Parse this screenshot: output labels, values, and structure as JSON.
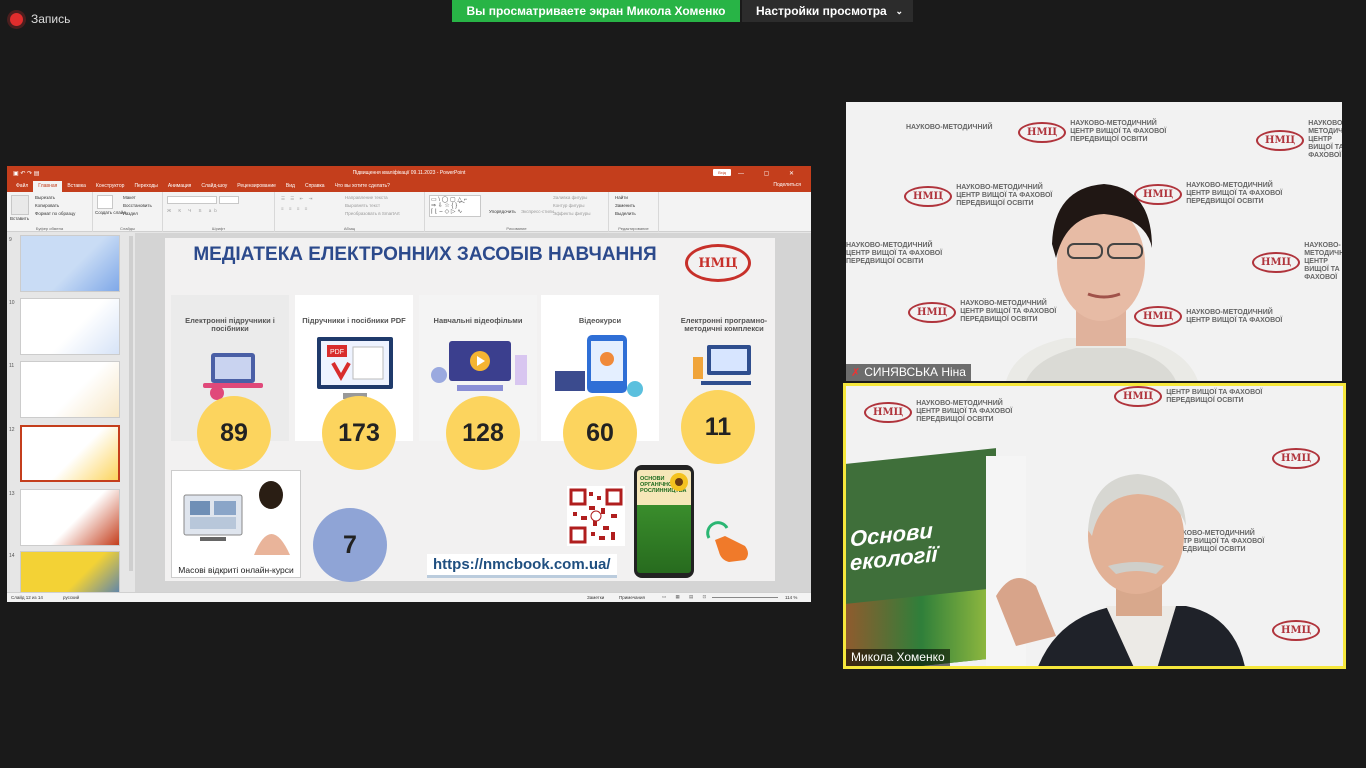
{
  "top_bar": {
    "recording_label": "Запись",
    "viewing_banner": "Вы просматриваете экран Микола Хоменко",
    "view_options_label": "Настройки просмотра"
  },
  "powerpoint": {
    "title": "Підвищення кваліфікації 09.11.2023 - PowerPoint",
    "sign_in": "Вхід",
    "window_controls": "— ▢ ✕",
    "tabs": [
      "Файл",
      "Главная",
      "Вставка",
      "Конструктор",
      "Переходы",
      "Анимация",
      "Слайд-шоу",
      "Рецензирование",
      "Вид",
      "Справка",
      "Что вы хотите сделать?"
    ],
    "active_tab": "Главная",
    "share": "Поделиться",
    "ribbon": {
      "clipboard": {
        "label": "Буфер обмена",
        "paste": "Вставить",
        "cut": "Вырезать",
        "copy": "Копировать",
        "format": "Формат по образцу"
      },
      "slides": {
        "label": "Слайды",
        "create": "Создать слайд",
        "layout": "Макет",
        "reset": "Восстановить",
        "section": "Раздел"
      },
      "font": {
        "label": "Шрифт"
      },
      "paragraph": {
        "label": "Абзац",
        "direction": "Направление текста",
        "align": "Выровнять текст",
        "smartart": "Преобразовать в SmartArt"
      },
      "drawing": {
        "label": "Рисование",
        "arrange": "Упорядочить",
        "styles": "Экспресс-стили",
        "fill": "Заливка фигуры",
        "outline": "Контур фигуры",
        "effects": "Эффекты фигуры"
      },
      "editing": {
        "label": "Редактирование",
        "find": "Найти",
        "replace": "Заменить",
        "select": "Выделить"
      }
    },
    "thumbnails": [
      {
        "num": "9"
      },
      {
        "num": "10"
      },
      {
        "num": "11"
      },
      {
        "num": "12",
        "selected": true
      },
      {
        "num": "13"
      },
      {
        "num": "14"
      }
    ],
    "status": {
      "slide_info": "Слайд 12 из 14",
      "language": "русский",
      "notes": "Заметки",
      "comments": "Примечания",
      "zoom": "114 %"
    }
  },
  "slide": {
    "title": "МЕДІАТЕКА ЕЛЕКТРОННИХ ЗАСОБІВ НАВЧАННЯ",
    "logo": "НМЦ",
    "categories": [
      {
        "label": "Електронні підручники і посібники",
        "count": "89"
      },
      {
        "label": "Підручники і посібники PDF",
        "count": "173"
      },
      {
        "label": "Навчальні відеофільми",
        "count": "128"
      },
      {
        "label": "Відеокурси",
        "count": "60"
      },
      {
        "label": "Електронні програмно-методичні комплекси",
        "count": "11"
      }
    ],
    "mooc": {
      "label": "Масові відкриті онлайн-курси",
      "count": "7"
    },
    "url": "https://nmcbook.com.ua/",
    "phone_book_title": "ОСНОВИ ОРГАНІЧНОГО РОСЛИННИЦТВА"
  },
  "participants": [
    {
      "name": "СИНЯВСЬКА Ніна",
      "muted": true
    },
    {
      "name": "Микола Хоменко",
      "muted": false
    }
  ],
  "watermark": {
    "abbr": "НМЦ",
    "line1": "НАУКОВО-МЕТОДИЧНИЙ",
    "line2": "ЦЕНТР ВИЩОЇ ТА ФАХОВОЇ",
    "line3": "ПЕРЕДВИЩОЇ ОСВІТИ"
  },
  "book_cover_text": "Основи екології",
  "colors": {
    "ppt_accent": "#c43e1c",
    "viewing_green": "#28b446",
    "active_speaker": "#f6e73c",
    "title_blue": "#2c4a8c",
    "count_yellow": "#fcd45e",
    "count_blue": "#8fa4d6"
  }
}
